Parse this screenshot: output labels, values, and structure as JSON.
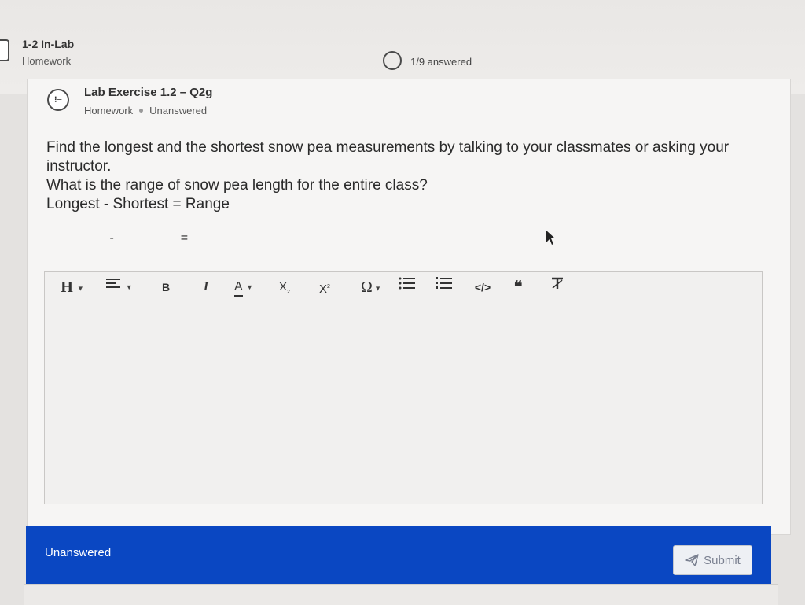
{
  "header": {
    "assignment_title": "1-2 In-Lab",
    "assignment_type": "Homework",
    "progress_text": "1/9 answered"
  },
  "question": {
    "title": "Lab Exercise 1.2 – Q2g",
    "category": "Homework",
    "status": "Unanswered",
    "prompt_line1": "Find the longest and the shortest snow pea measurements by talking to your classmates or asking your instructor.",
    "prompt_line2": "What is the range of snow pea length for the entire class?",
    "prompt_line3": "Longest - Shortest = Range",
    "blank_minus": "-",
    "blank_equals": "="
  },
  "toolbar": {
    "heading": "H",
    "bold": "B",
    "italic": "I",
    "font_color": "A",
    "subscript": "X",
    "superscript": "X",
    "special_chars": "Ω",
    "code": "</>",
    "quote": "66"
  },
  "footer": {
    "status": "Unanswered",
    "submit_label": "Submit"
  },
  "colors": {
    "footer_bar": "#0a47c2",
    "submit_text": "#7a8090"
  }
}
